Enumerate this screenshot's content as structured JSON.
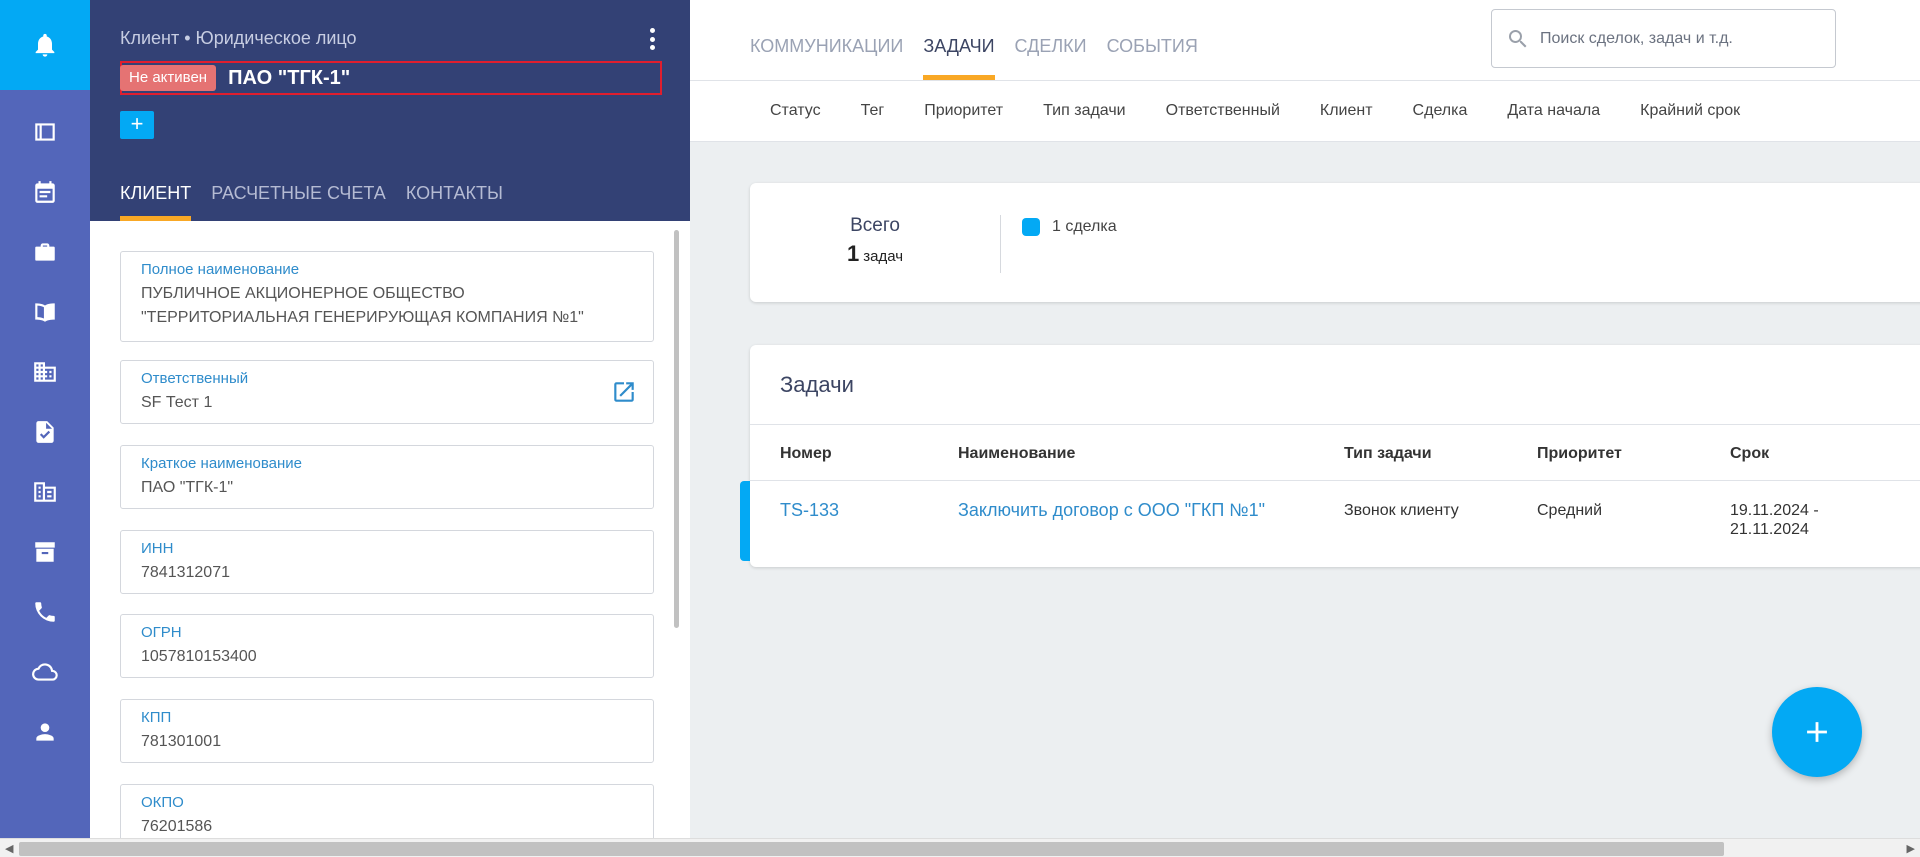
{
  "client": {
    "subtitle": "Клиент • Юридическое лицо",
    "status_badge": "Не активен",
    "name": "ПАО \"ТГК-1\"",
    "add_label": "+",
    "tabs": [
      {
        "label": "КЛИЕНТ"
      },
      {
        "label": "РАСЧЕТНЫЕ СЧЕТА"
      },
      {
        "label": "КОНТАКТЫ"
      }
    ],
    "fields": [
      {
        "label": "Полное наименование",
        "value": "ПУБЛИЧНОЕ АКЦИОНЕРНОЕ ОБЩЕСТВО \"ТЕРРИТОРИАЛЬНАЯ ГЕНЕРИРУЮЩАЯ КОМПАНИЯ №1\""
      },
      {
        "label": "Ответственный",
        "value": "SF Тест 1"
      },
      {
        "label": "Краткое наименование",
        "value": "ПАО \"ТГК-1\""
      },
      {
        "label": "ИНН",
        "value": "7841312071"
      },
      {
        "label": "ОГРН",
        "value": "1057810153400"
      },
      {
        "label": "КПП",
        "value": "781301001"
      },
      {
        "label": "ОКПО",
        "value": "76201586"
      }
    ]
  },
  "nav_icons": [
    "bell-icon",
    "board-icon",
    "calendar-icon",
    "briefcase-icon",
    "book-icon",
    "buildings-icon",
    "document-check-icon",
    "company-icon",
    "archive-icon",
    "phone-icon",
    "cloud-icon",
    "user-icon"
  ],
  "main": {
    "tabs": [
      {
        "label": "КОММУНИКАЦИИ"
      },
      {
        "label": "ЗАДАЧИ"
      },
      {
        "label": "СДЕЛКИ"
      },
      {
        "label": "СОБЫТИЯ"
      }
    ],
    "search_placeholder": "Поиск сделок, задач и т.д.",
    "filters": [
      "Статус",
      "Тег",
      "Приоритет",
      "Тип задачи",
      "Ответственный",
      "Клиент",
      "Сделка",
      "Дата начала",
      "Крайний срок"
    ],
    "summary": {
      "total_label": "Всего",
      "count": "1",
      "unit": "задач",
      "legend": "1 сделка",
      "legend_color": "#03a9f4"
    },
    "tasks": {
      "title": "Задачи",
      "columns": [
        "Номер",
        "Наименование",
        "Тип задачи",
        "Приоритет",
        "Срок"
      ],
      "rows": [
        {
          "number": "TS-133",
          "name": "Заключить договор с ООО \"ГКП №1\"",
          "type": "Звонок клиенту",
          "priority": "Средний",
          "due_from": "19.11.2024 -",
          "due_to": "21.11.2024"
        }
      ]
    }
  },
  "colors": {
    "rail": "#5366ba",
    "rail_active": "#03a9f4",
    "panel_header": "#334175",
    "accent": "#f9a825",
    "link": "#2f8ccb",
    "badge_inactive": "#e57373"
  }
}
